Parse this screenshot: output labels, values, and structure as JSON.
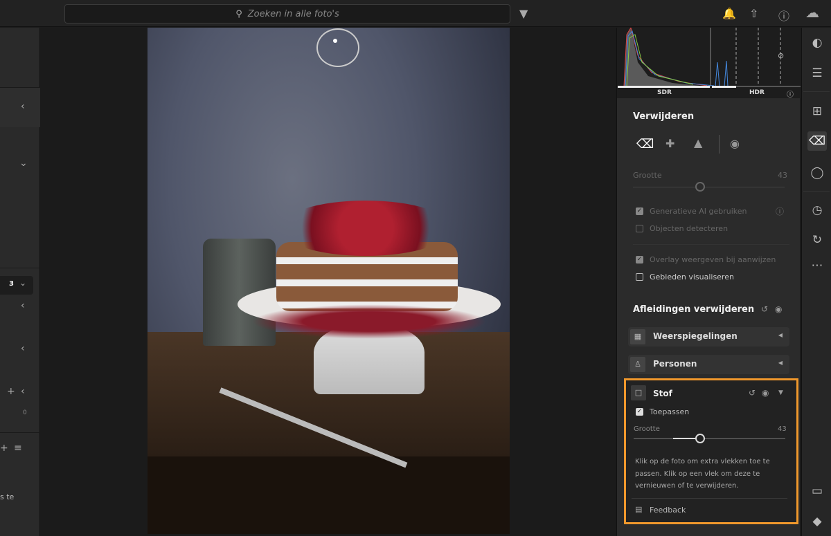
{
  "topbar": {
    "search_placeholder": "Zoeken in alle foto's"
  },
  "left_panel": {
    "count": "3",
    "zero": "0",
    "partial_text": "s te"
  },
  "histogram": {
    "sdr_label": "SDR",
    "hdr_label": "HDR"
  },
  "remove": {
    "title": "Verwijderen",
    "size_label": "Grootte",
    "size_value": "43",
    "size_percent": 43,
    "generative_ai": "Generatieve AI gebruiken",
    "detect_objects": "Objecten detecteren",
    "overlay": "Overlay weergeven bij aanwijzen",
    "visualize": "Gebieden visualiseren"
  },
  "distractions": {
    "title": "Afleidingen verwijderen",
    "items": [
      {
        "label": "Weerspiegelingen"
      },
      {
        "label": "Personen"
      }
    ]
  },
  "dust": {
    "title": "Stof",
    "apply": "Toepassen",
    "size_label": "Grootte",
    "size_value": "43",
    "size_percent": 43,
    "help": "Klik op de foto om extra vlekken toe te passen. Klik op een vlek om deze te vernieuwen of te verwijderen.",
    "feedback": "Feedback"
  },
  "colors": {
    "accent": "#f0982c"
  }
}
